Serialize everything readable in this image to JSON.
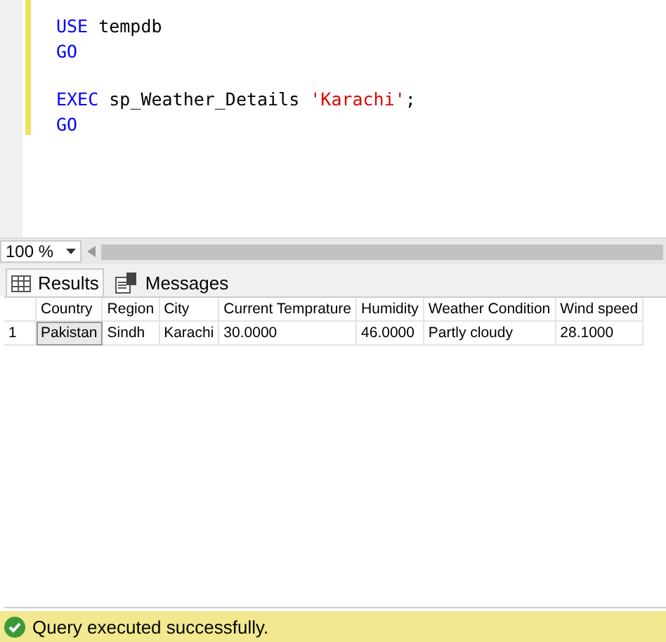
{
  "editor": {
    "blocks": [
      [
        {
          "tokens": [
            {
              "text": "USE",
              "kind": "keyword"
            },
            {
              "text": "tempdb",
              "kind": "plain"
            }
          ]
        },
        {
          "tokens": [
            {
              "text": "GO",
              "kind": "keyword"
            }
          ]
        }
      ],
      [
        {
          "tokens": [
            {
              "text": "EXEC",
              "kind": "keyword"
            },
            {
              "text": "sp_Weather_Details",
              "kind": "plain"
            },
            {
              "text": "'Karachi'",
              "kind": "string"
            },
            {
              "text": ";",
              "kind": "plain",
              "attached": true
            }
          ]
        },
        {
          "tokens": [
            {
              "text": "GO",
              "kind": "keyword"
            }
          ]
        }
      ]
    ]
  },
  "zoom": {
    "value": "100 %"
  },
  "tabs": [
    {
      "label": "Results",
      "selected": true,
      "kind": "grid"
    },
    {
      "label": "Messages",
      "selected": false,
      "kind": "messages"
    }
  ],
  "table": {
    "columns": [
      "Country",
      "Region",
      "City",
      "Current Temprature",
      "Humidity",
      "Weather Condition",
      "Wind speed"
    ],
    "rows": [
      {
        "number": "1",
        "cells": [
          {
            "text": "Pakistan",
            "selected": true
          },
          {
            "text": "Sindh",
            "selected": false
          },
          {
            "text": "Karachi",
            "selected": false
          },
          {
            "text": "30.0000",
            "selected": false
          },
          {
            "text": "46.0000",
            "selected": false
          },
          {
            "text": "Partly cloudy",
            "selected": false
          },
          {
            "text": "28.1000",
            "selected": false
          }
        ]
      }
    ]
  },
  "status_bar": {
    "text": "Query executed successfully.",
    "succeeded": true
  }
}
